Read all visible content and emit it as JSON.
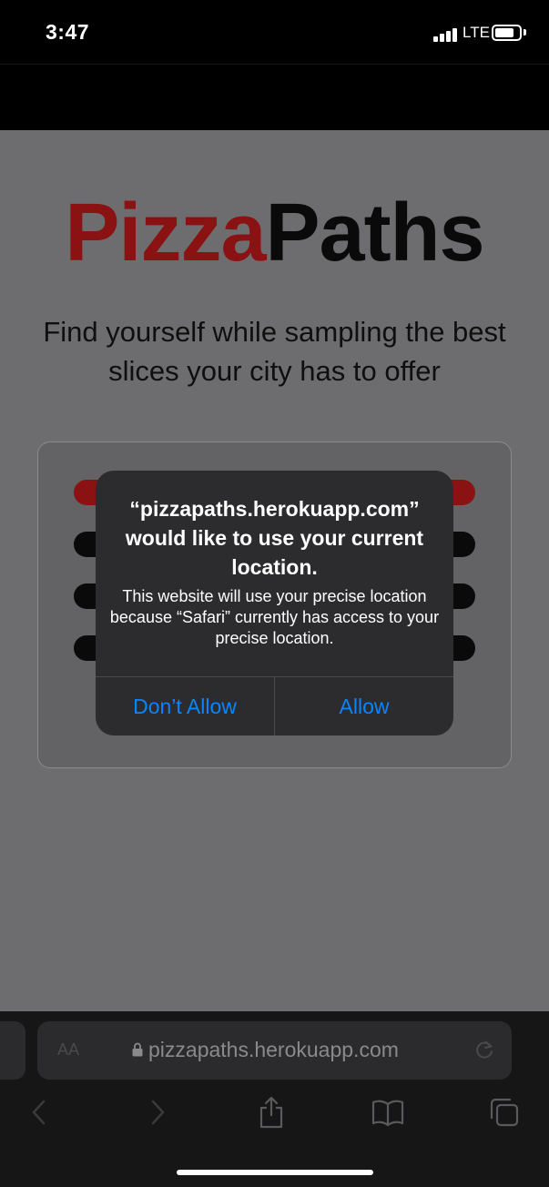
{
  "status_bar": {
    "time": "3:47",
    "network": "LTE",
    "icons": [
      "cellular-signal-icon",
      "battery-icon"
    ]
  },
  "page": {
    "logo_part1": "Pizza",
    "logo_part2": "Paths",
    "tagline": "Find yourself while sampling the best slices your city has to offer",
    "colors": {
      "logo_red": "#8b1212",
      "overlay_bg": "#6d6d6f"
    }
  },
  "dialog": {
    "title": "“pizzapaths.herokuapp.com” would like to use your current location.",
    "message": "This website will use your precise location because “Safari” currently has access to your precise location.",
    "deny_label": "Don’t Allow",
    "allow_label": "Allow",
    "button_color": "#0a84ff"
  },
  "browser": {
    "text_size_label": "AA",
    "url": "pizzapaths.herokuapp.com",
    "toolbar_icons": [
      "back-icon",
      "forward-icon",
      "share-icon",
      "bookmarks-icon",
      "tabs-icon"
    ]
  }
}
